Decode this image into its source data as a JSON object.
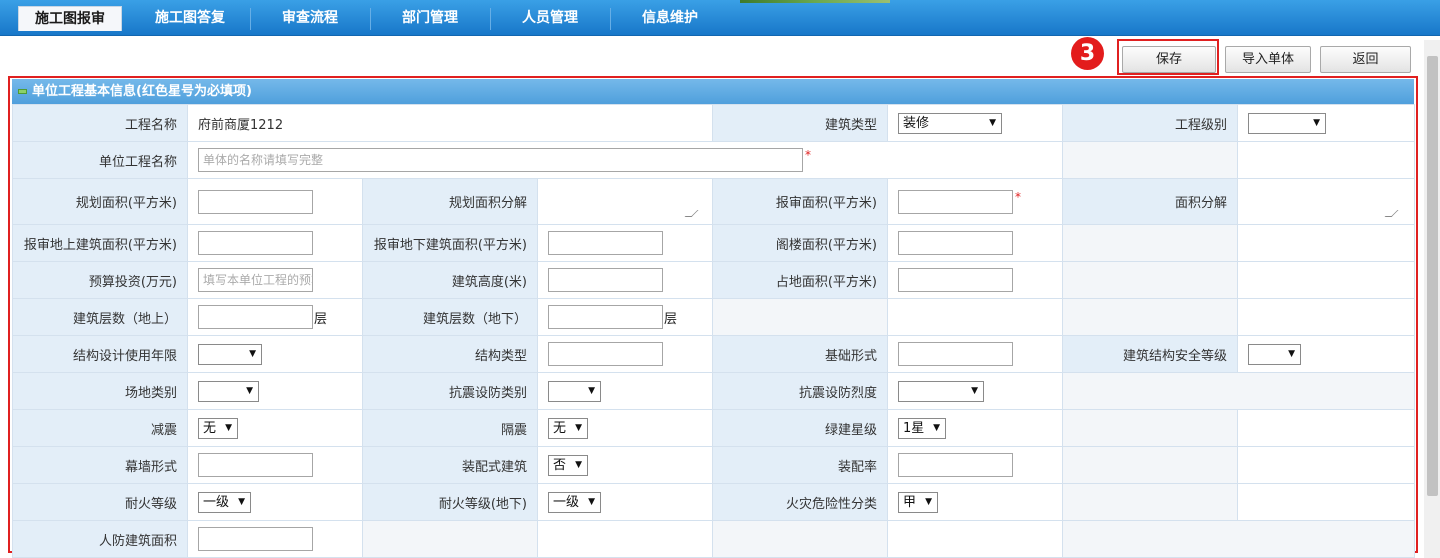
{
  "nav": {
    "tabs": [
      {
        "label": "施工图报审",
        "active": true
      },
      {
        "label": "施工图答复"
      },
      {
        "label": "审查流程"
      },
      {
        "label": "部门管理"
      },
      {
        "label": "人员管理"
      },
      {
        "label": "信息维护"
      }
    ]
  },
  "annotation": {
    "step": "3",
    "highlight_color": "#e02020"
  },
  "actions": {
    "save": "保存",
    "import": "导入单体",
    "back": "返回"
  },
  "panel": {
    "title": "单位工程基本信息(红色星号为必填项)"
  },
  "required_mark": "*",
  "form": {
    "project_name_label": "工程名称",
    "project_name_value": "府前商厦1212",
    "building_type_label": "建筑类型",
    "building_type_value": "装修",
    "project_level_label": "工程级别",
    "project_level_value": "",
    "unit_name_label": "单位工程名称",
    "unit_name_placeholder": "单体的名称请填写完整",
    "plan_area_label": "规划面积(平方米)",
    "plan_area_split_label": "规划面积分解",
    "review_area_label": "报审面积(平方米)",
    "area_split_label": "面积分解",
    "above_ground_area_label": "报审地上建筑面积(平方米)",
    "under_ground_area_label": "报审地下建筑面积(平方米)",
    "attic_area_label": "阁楼面积(平方米)",
    "budget_label": "预算投资(万元)",
    "budget_placeholder": "填写本单位工程的预算投资",
    "building_height_label": "建筑高度(米)",
    "land_area_label": "占地面积(平方米)",
    "floors_above_label": "建筑层数（地上）",
    "floors_below_label": "建筑层数（地下）",
    "floor_unit": "层",
    "design_life_label": "结构设计使用年限",
    "structure_type_label": "结构类型",
    "foundation_label": "基础形式",
    "safety_grade_label": "建筑结构安全等级",
    "site_category_label": "场地类别",
    "seismic_category_label": "抗震设防类别",
    "seismic_intensity_label": "抗震设防烈度",
    "damping_label": "减震",
    "damping_value": "无",
    "isolation_label": "隔震",
    "isolation_value": "无",
    "green_level_label": "绿建星级",
    "green_level_value": "1星",
    "curtain_wall_label": "幕墙形式",
    "prefab_label": "装配式建筑",
    "prefab_value": "否",
    "prefab_rate_label": "装配率",
    "fire_grade_label": "耐火等级",
    "fire_grade_value": "一级",
    "fire_grade_under_label": "耐火等级(地下)",
    "fire_grade_under_value": "一级",
    "fire_hazard_label": "火灾危险性分类",
    "fire_hazard_value": "甲",
    "civil_defense_label": "人防建筑面积"
  }
}
